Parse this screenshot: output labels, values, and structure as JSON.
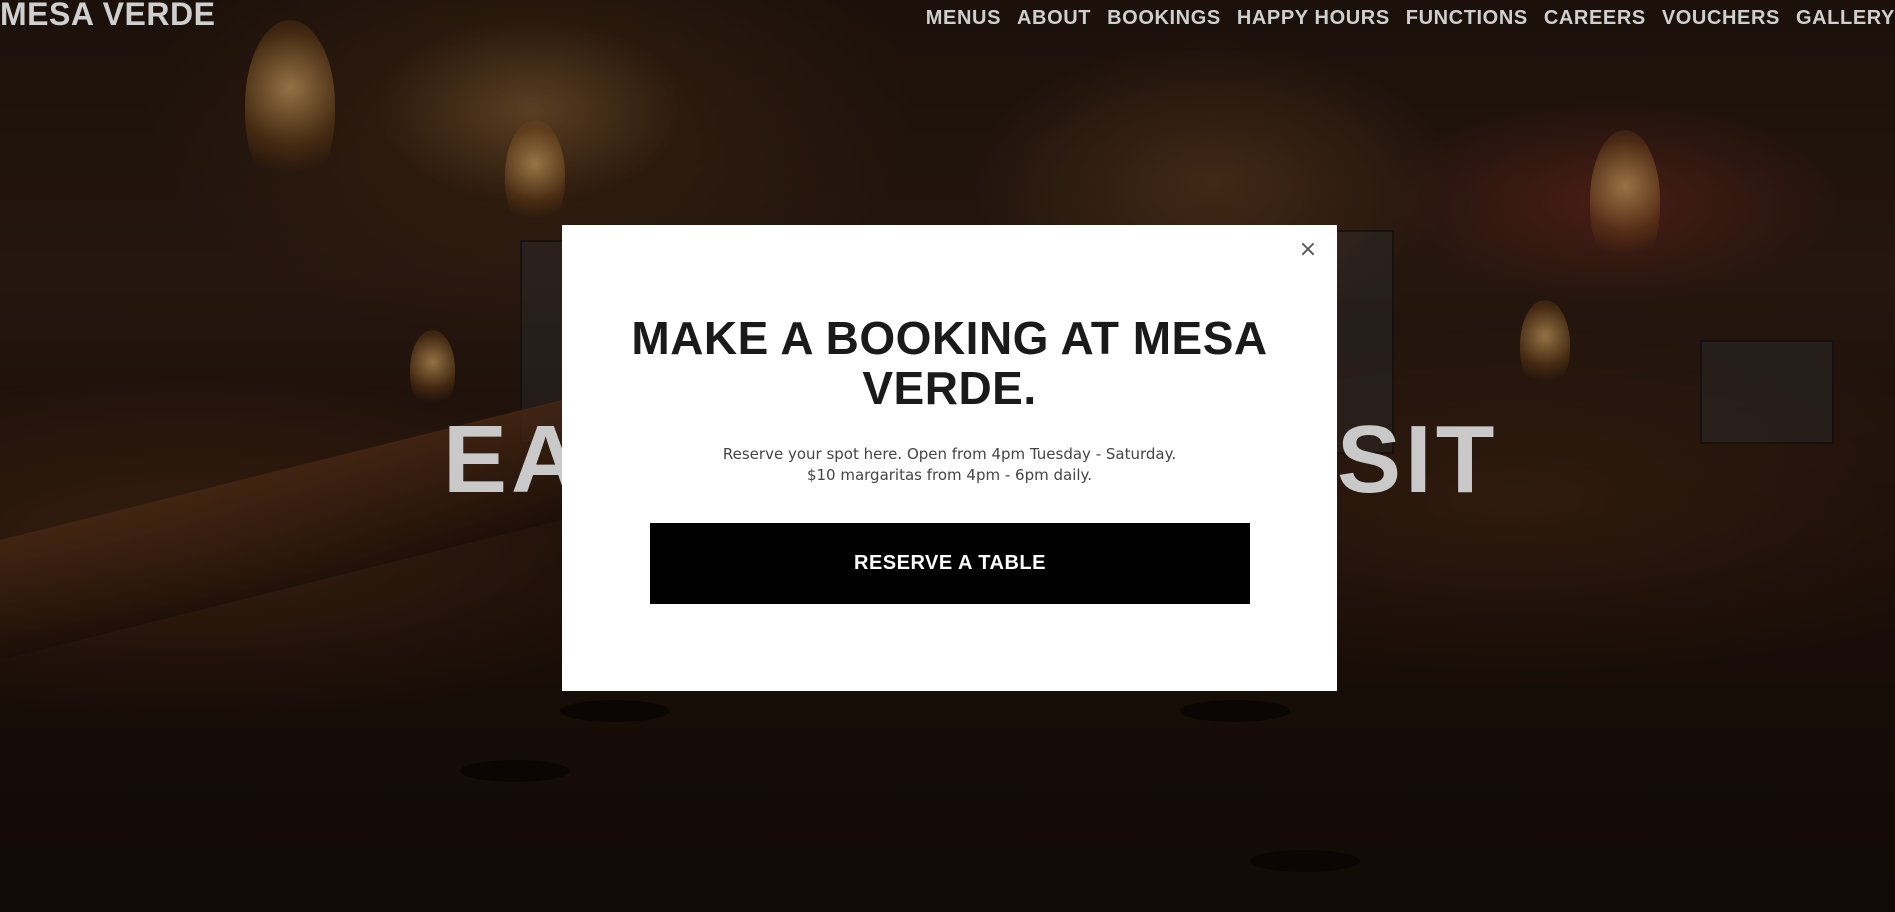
{
  "header": {
    "logo": "MESA VERDE",
    "nav": [
      {
        "label": "MENUS"
      },
      {
        "label": "ABOUT"
      },
      {
        "label": "BOOKINGS"
      },
      {
        "label": "HAPPY HOURS"
      },
      {
        "label": "FUNCTIONS"
      },
      {
        "label": "CAREERS"
      },
      {
        "label": "VOUCHERS"
      },
      {
        "label": "GALLERY"
      }
    ]
  },
  "hero": {
    "title_left": "EA",
    "title_right": "SIT"
  },
  "modal": {
    "close_icon": "×",
    "title": "MAKE A BOOKING AT MESA VERDE.",
    "text_line1": "Reserve your spot here. Open from 4pm Tuesday - Saturday.",
    "text_line2": "$10 margaritas from 4pm - 6pm daily.",
    "button_label": "RESERVE A TABLE"
  },
  "colors": {
    "modal_bg": "#ffffff",
    "button_bg": "#000000",
    "button_text": "#ffffff",
    "nav_text": "#cfcfcf"
  }
}
